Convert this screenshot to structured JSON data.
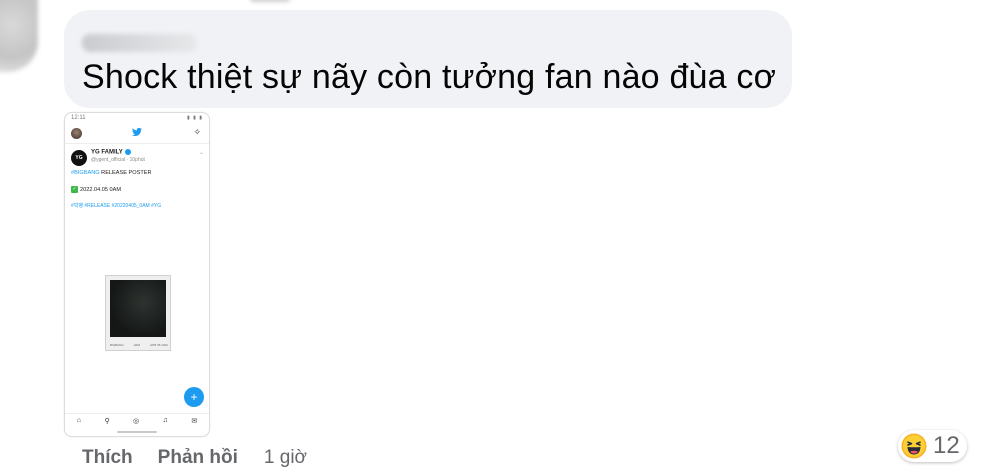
{
  "comment": {
    "text": "Shock thiệt sự nãy còn tưởng fan nào đùa cơ"
  },
  "attachment": {
    "status_time": "12:11",
    "status_icons": "▮ ▮ ▮",
    "account_name": "YG FAMILY",
    "account_handle": "@ygent_official · 10phút",
    "logo_text": "YG",
    "hashtag_bigbang": "#BIGBANG",
    "release_poster": " RELEASE POSTER",
    "date_line": "2022.04.05 0AM",
    "hashtags": "#빅뱅 #RELEASE #20220405_0AM #YG",
    "poster_caption": [
      "BIGBANG",
      "0AM",
      "APR 05 2022"
    ],
    "compose_symbol": "+",
    "nav_icons": [
      "⌂",
      "⚲",
      "◎",
      "♫",
      "✉"
    ]
  },
  "actions": {
    "like_label": "Thích",
    "reply_label": "Phản hồi",
    "timestamp": "1 giờ"
  },
  "reactions": {
    "icon": "haha-emoji",
    "count": "12"
  }
}
